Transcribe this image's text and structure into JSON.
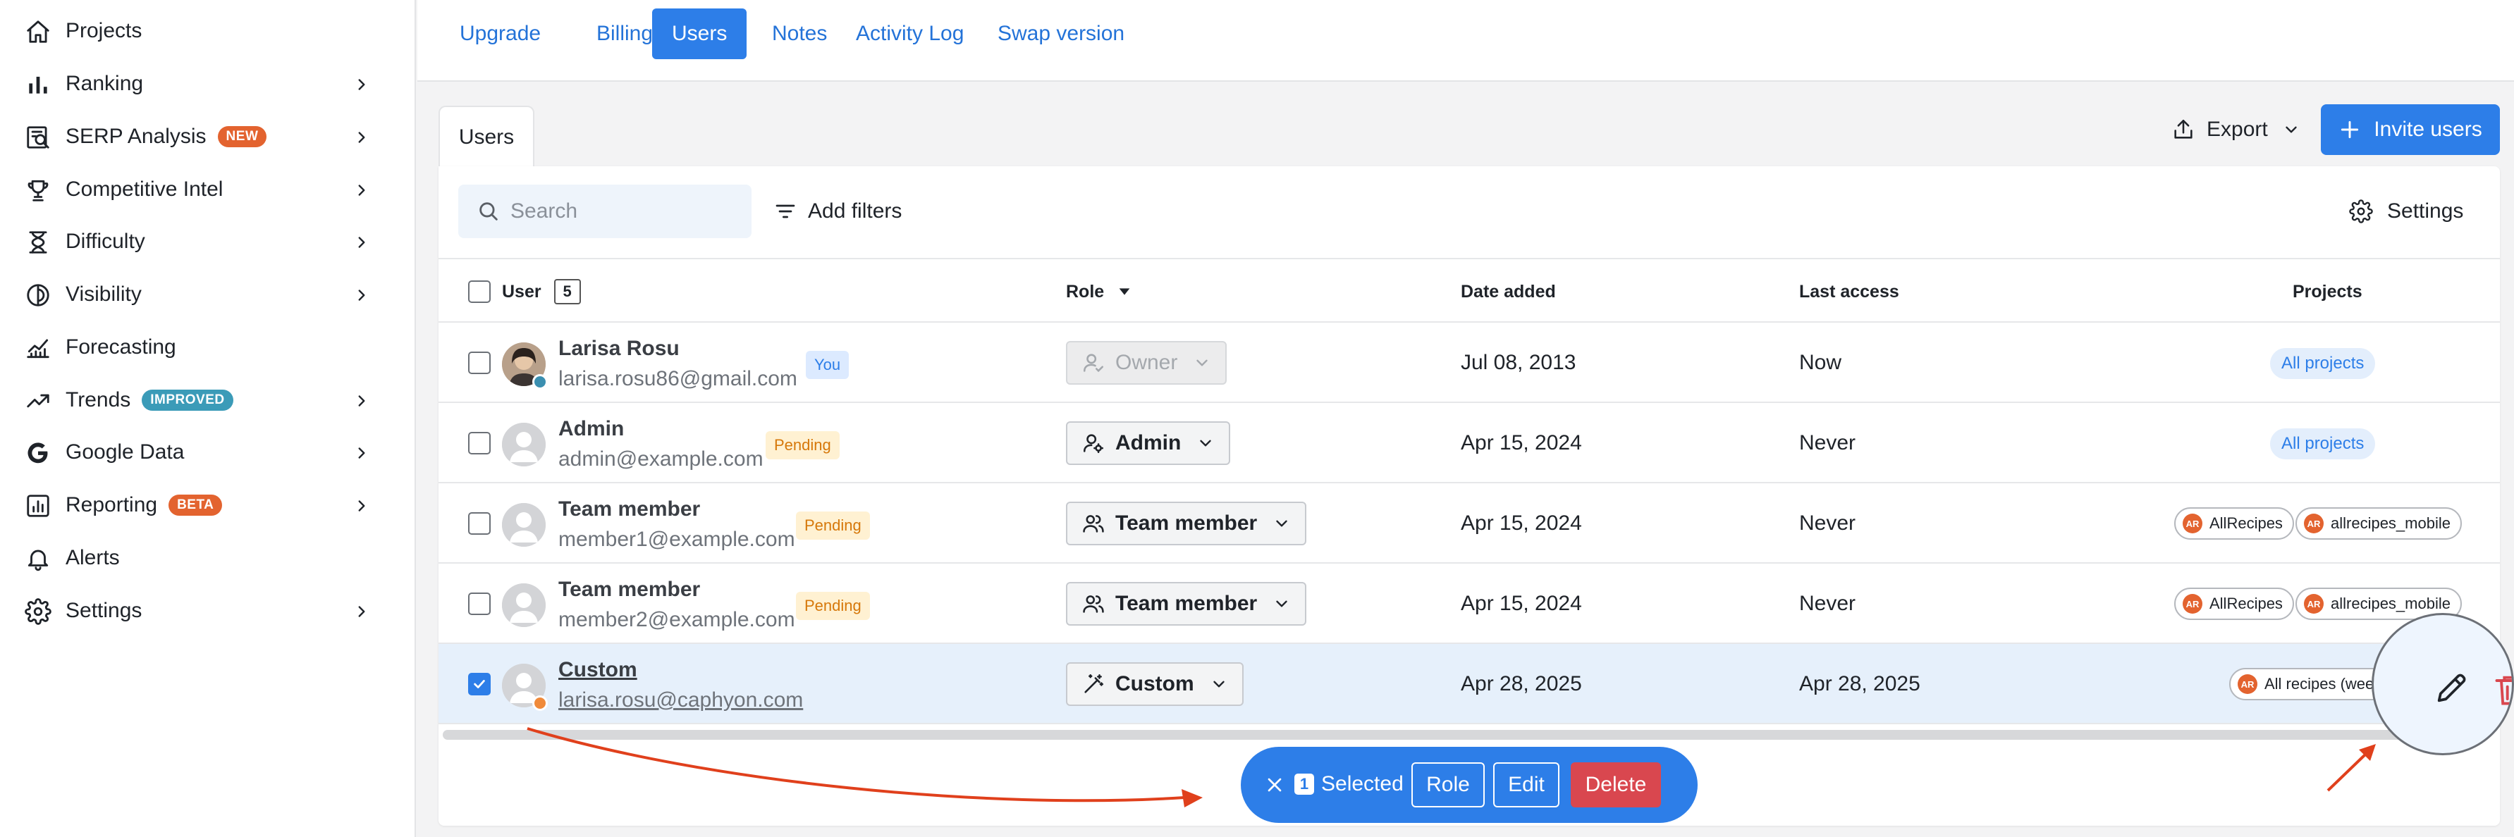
{
  "sidebar": {
    "items": [
      {
        "label": "Projects",
        "icon": "home-icon"
      },
      {
        "label": "Ranking",
        "icon": "bar-chart-icon"
      },
      {
        "label": "SERP Analysis",
        "icon": "serp-icon",
        "badge": "NEW",
        "badge_color": "#e3632f"
      },
      {
        "label": "Competitive Intel",
        "icon": "trophy-icon"
      },
      {
        "label": "Difficulty",
        "icon": "hourglass-icon"
      },
      {
        "label": "Visibility",
        "icon": "visibility-icon"
      },
      {
        "label": "Forecasting",
        "icon": "forecast-icon"
      },
      {
        "label": "Trends",
        "icon": "trend-icon",
        "badge": "IMPROVED",
        "badge_color": "#3b9bb8"
      },
      {
        "label": "Google Data",
        "icon": "google-icon"
      },
      {
        "label": "Reporting",
        "icon": "report-icon",
        "badge": "BETA",
        "badge_color": "#e3632f"
      },
      {
        "label": "Alerts",
        "icon": "bell-icon"
      },
      {
        "label": "Settings",
        "icon": "gear-icon"
      }
    ]
  },
  "topnav": {
    "tabs": [
      {
        "label": "Upgrade"
      },
      {
        "label": "Billing"
      },
      {
        "label": "Users",
        "active": true
      },
      {
        "label": "Notes"
      },
      {
        "label": "Activity Log"
      },
      {
        "label": "Swap version"
      }
    ]
  },
  "users_panel": {
    "tab_label": "Users",
    "export_label": "Export",
    "invite_label": "Invite users",
    "search_placeholder": "Search",
    "filters_label": "Add filters",
    "settings_label": "Settings"
  },
  "table": {
    "headers": {
      "user": "User",
      "count": "5",
      "role": "Role",
      "date_added": "Date added",
      "last_access": "Last access",
      "projects": "Projects"
    },
    "rows": [
      {
        "name": "Larisa Rosu",
        "email": "larisa.rosu86@gmail.com",
        "tag": "You",
        "tag_type": "you",
        "role": "Owner",
        "role_icon": "owner-icon",
        "role_disabled": true,
        "date_added": "Jul 08, 2013",
        "last_access": "Now",
        "projects": [
          "All projects"
        ],
        "projects_type": "all",
        "checked": false,
        "photo": true,
        "status_color": "#3b8fb0"
      },
      {
        "name": "Admin",
        "email": "admin@example.com",
        "tag": "Pending",
        "tag_type": "pending",
        "role": "Admin",
        "role_icon": "admin-icon",
        "role_disabled": false,
        "date_added": "Apr 15, 2024",
        "last_access": "Never",
        "projects": [
          "All projects"
        ],
        "projects_type": "all",
        "checked": false,
        "photo": false
      },
      {
        "name": "Team member",
        "email": "member1@example.com",
        "tag": "Pending",
        "tag_type": "pending",
        "role": "Team member",
        "role_icon": "team-icon",
        "role_disabled": false,
        "date_added": "Apr 15, 2024",
        "last_access": "Never",
        "projects": [
          "AllRecipes",
          "allrecipes_mobile"
        ],
        "projects_type": "chips",
        "checked": false,
        "photo": false
      },
      {
        "name": "Team member",
        "email": "member2@example.com",
        "tag": "Pending",
        "tag_type": "pending",
        "role": "Team member",
        "role_icon": "team-icon",
        "role_disabled": false,
        "date_added": "Apr 15, 2024",
        "last_access": "Never",
        "projects": [
          "AllRecipes",
          "allrecipes_mobile"
        ],
        "projects_type": "chips",
        "checked": false,
        "photo": false
      },
      {
        "name": "Custom",
        "email": "larisa.rosu@caphyon.com",
        "tag": "",
        "tag_type": "",
        "role": "Custom",
        "role_icon": "custom-icon",
        "role_disabled": false,
        "date_added": "Apr 28, 2025",
        "last_access": "Apr 28, 2025",
        "projects": [
          "All recipes (wee"
        ],
        "projects_type": "chips",
        "checked": true,
        "photo": false,
        "status_color": "#f08a3a"
      }
    ]
  },
  "project_logo_text": "AR",
  "bulk_bar": {
    "count": "1",
    "label": "Selected",
    "role_label": "Role",
    "edit_label": "Edit",
    "delete_label": "Delete"
  },
  "colors": {
    "accent": "#2d7ee8",
    "danger": "#d9474f",
    "annotation_arrow": "#e0401c"
  }
}
